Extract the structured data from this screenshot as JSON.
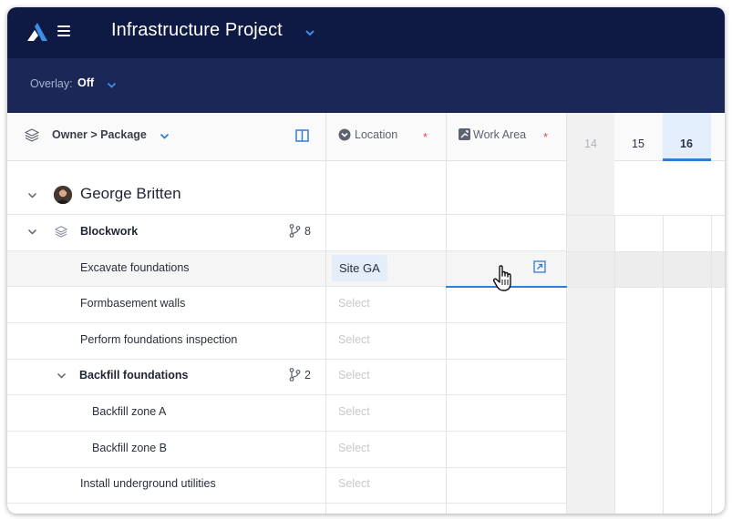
{
  "app": {
    "project_title": "Infrastructure Project"
  },
  "overlay": {
    "label": "Overlay:",
    "value": "Off"
  },
  "columns": {
    "owner_package": "Owner > Package",
    "location": "Location",
    "work_area": "Work Area",
    "required_marker": "*"
  },
  "timeline": {
    "days": [
      "14",
      "15",
      "16"
    ],
    "today": "16"
  },
  "owner": {
    "name": "George Britten"
  },
  "packages": [
    {
      "label": "Blockwork",
      "count": "8"
    },
    {
      "label": "Backfill foundations",
      "count": "2"
    }
  ],
  "tasks": [
    {
      "label": "Excavate foundations",
      "location": "Site GA"
    },
    {
      "label": "Formbasement walls",
      "location": "Select"
    },
    {
      "label": "Perform foundations inspection",
      "location": "Select"
    },
    {
      "label": "Backfill zone A",
      "location": "Select"
    },
    {
      "label": "Backfill zone B",
      "location": "Select"
    },
    {
      "label": "Install underground utilities",
      "location": "Select"
    }
  ],
  "package_location_placeholder": "Select",
  "colors": {
    "nav_bg": "#0e1a44",
    "overlay_bg": "#1b2756",
    "accent": "#2f7fd6",
    "required": "#e5484d",
    "chip_bg": "#e4eef8"
  },
  "icons": {
    "logo": "logo-icon",
    "menu": "hamburger-icon",
    "layers": "layers-icon",
    "split": "split-view-icon",
    "location": "location-chevron-icon",
    "work_area": "work-area-icon",
    "branch": "branch-icon",
    "open": "open-external-icon",
    "cursor": "hand-cursor-icon"
  }
}
